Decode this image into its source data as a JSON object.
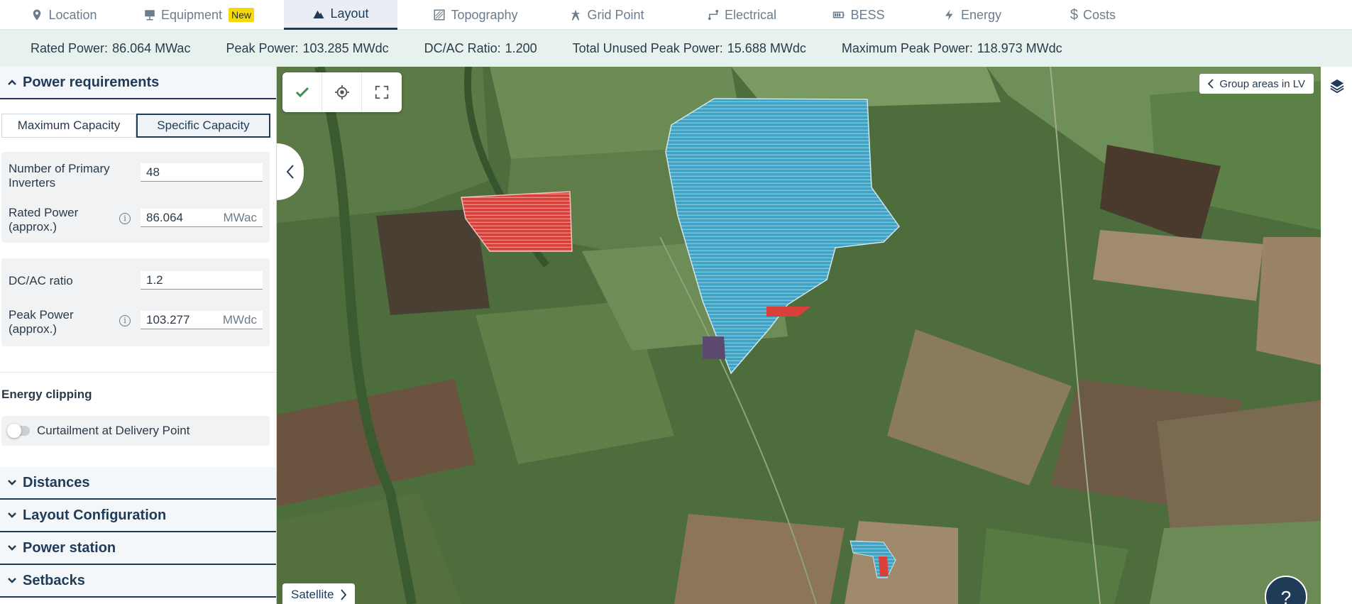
{
  "tabs": [
    {
      "label": "Location",
      "icon": "pin-icon"
    },
    {
      "label": "Equipment",
      "icon": "panel-icon",
      "badge": "New"
    },
    {
      "label": "Layout",
      "icon": "mountain-icon",
      "active": true
    },
    {
      "label": "Topography",
      "icon": "topography-icon"
    },
    {
      "label": "Grid Point",
      "icon": "tower-icon"
    },
    {
      "label": "Electrical",
      "icon": "electrical-icon"
    },
    {
      "label": "BESS",
      "icon": "battery-icon"
    },
    {
      "label": "Energy",
      "icon": "bolt-icon"
    },
    {
      "label": "Costs",
      "icon": "dollar-icon"
    }
  ],
  "summary": {
    "rated_label": "Rated Power:",
    "rated_value": "86.064 MWac",
    "peak_label": "Peak Power:",
    "peak_value": "103.285 MWdc",
    "ratio_label": "DC/AC Ratio:",
    "ratio_value": "1.200",
    "unused_label": "Total Unused Peak Power:",
    "unused_value": "15.688 MWdc",
    "max_label": "Maximum Peak Power:",
    "max_value": "118.973 MWdc"
  },
  "panel": {
    "power_req": "Power requirements",
    "seg_max": "Maximum Capacity",
    "seg_specific": "Specific Capacity",
    "inverters_label": "Number of Primary Inverters",
    "inverters_value": "48",
    "rated_label": "Rated Power (approx.)",
    "rated_value": "86.064",
    "rated_unit": "MWac",
    "dcac_label": "DC/AC ratio",
    "dcac_value": "1.2",
    "peak_label": "Peak Power (approx.)",
    "peak_value": "103.277",
    "peak_unit": "MWdc",
    "energy_clipping": "Energy clipping",
    "curtailment": "Curtailment at Delivery Point",
    "distances": "Distances",
    "layout_config": "Layout Configuration",
    "power_station": "Power station",
    "setbacks": "Setbacks"
  },
  "map": {
    "group_areas": "Group areas in LV",
    "satellite": "Satellite",
    "help": "?",
    "colors": {
      "blue_area": "#3fa3c6",
      "red_area": "#d9403a",
      "purple_area": "#5c4a6e"
    }
  }
}
